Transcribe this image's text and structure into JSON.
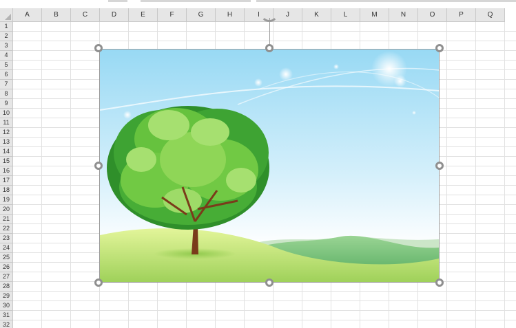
{
  "columns": [
    "A",
    "B",
    "C",
    "D",
    "E",
    "F",
    "G",
    "H",
    "I",
    "J",
    "K",
    "L",
    "M",
    "N",
    "O",
    "P",
    "Q"
  ],
  "rows": [
    "1",
    "2",
    "3",
    "4",
    "5",
    "6",
    "7",
    "8",
    "9",
    "10",
    "11",
    "12",
    "13",
    "14",
    "15",
    "16",
    "17",
    "18",
    "19",
    "20",
    "21",
    "22",
    "23",
    "24",
    "25",
    "26",
    "27",
    "28",
    "29",
    "30",
    "31",
    "32"
  ],
  "picture": {
    "name": "tree-landscape-picture",
    "icon": "tree-landscape-image",
    "selected": true
  },
  "colors": {
    "sky_top": "#9fdcf5",
    "sky_bottom": "#ffffff",
    "grass": "#b9df7a",
    "hills": "#6cbf73",
    "foliage": "#5fbf3a",
    "trunk": "#7a3b1a",
    "handle_border": "#8f8f8f",
    "header_bg": "#e6e6e6",
    "gridline": "#e1e1e1"
  }
}
